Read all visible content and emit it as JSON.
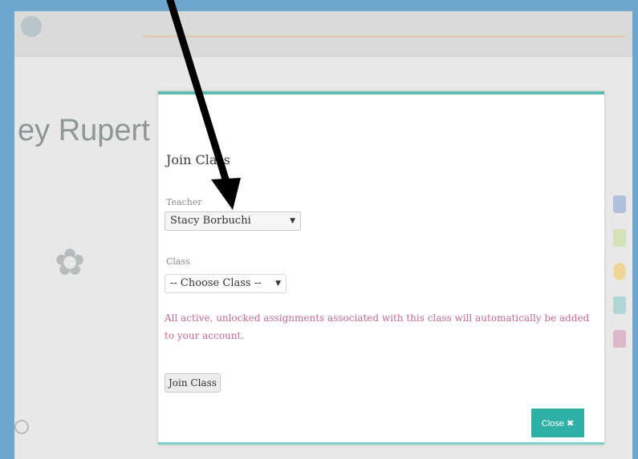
{
  "background": {
    "logo_text": "",
    "breadcrumb": "",
    "student_name": "ey Rupert",
    "avatar_caption": "",
    "bottom_item": ""
  },
  "modal": {
    "title": "Join Class",
    "teacher_label": "Teacher",
    "teacher_value": "Stacy Borbuchi",
    "class_label": "Class",
    "class_value": "-- Choose Class --",
    "notice": "All active, unlocked assignments associated with this class will automatically be added to your account.",
    "join_button": "Join Class",
    "close_button": "Close"
  },
  "icons": {
    "teacher_select_arrow": "chevron-down-icon",
    "class_select_arrow": "chevron-down-icon",
    "annotation": "arrow-icon"
  },
  "colors": {
    "modal_accent": "#5bbcb0",
    "notice_text": "#c56a8b",
    "close_button": "#2fb0a7"
  }
}
